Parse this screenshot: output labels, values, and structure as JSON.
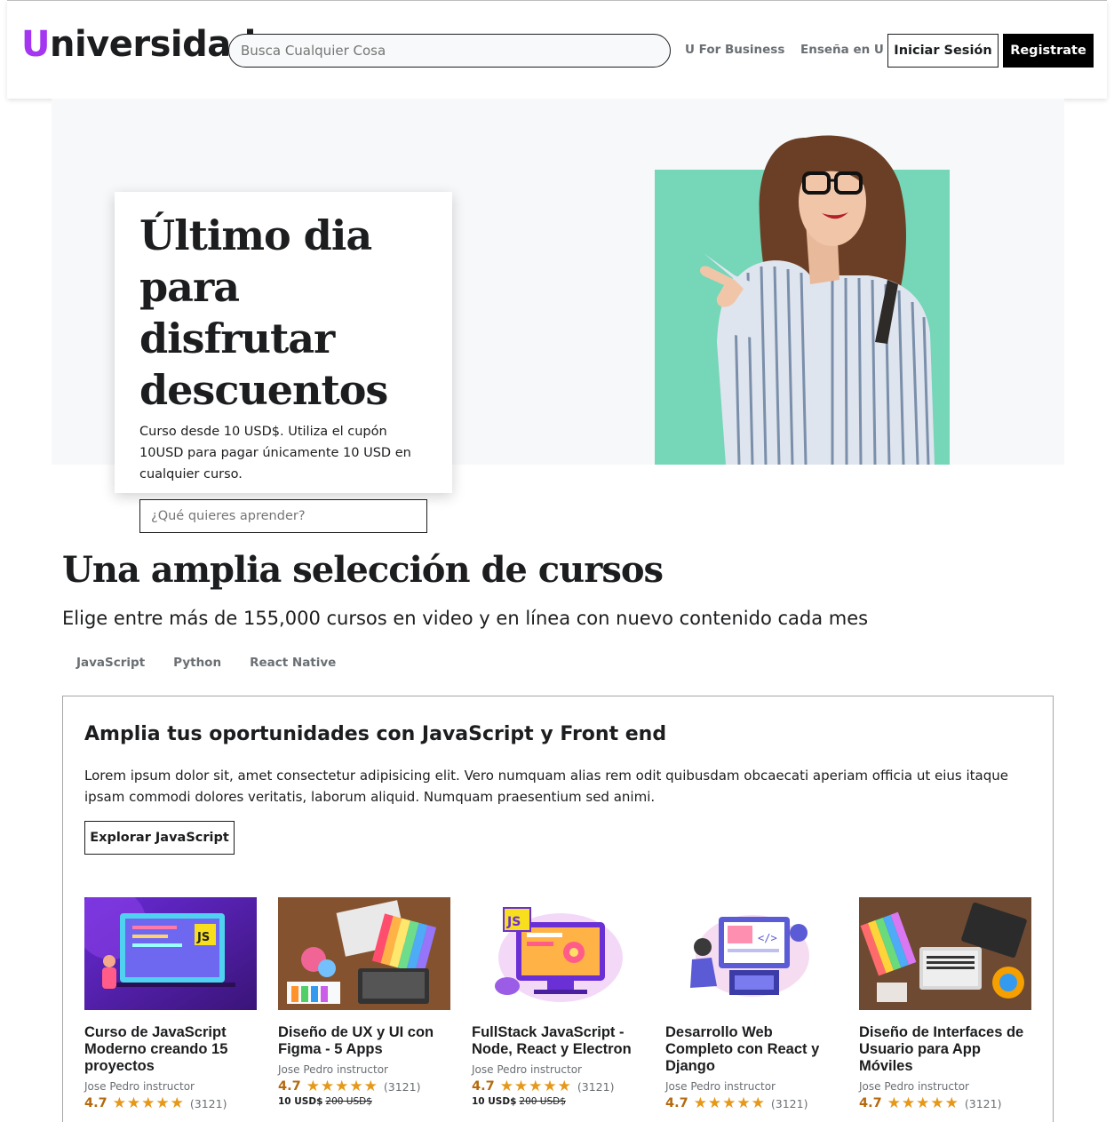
{
  "header": {
    "logo_initial": "U",
    "logo_rest": "niversidad",
    "search_placeholder": "Busca Cualquier Cosa",
    "link_business": "U For Business",
    "link_teach": "Enseña en U",
    "login_label": "Iniciar Sesión",
    "register_label": "Registrate"
  },
  "hero": {
    "title": "Último dia para disfrutar descuentos",
    "text": "Curso desde 10 USD$. Utiliza el cupón 10USD para pagar únicamente 10 USD en cualquier curso.",
    "input_placeholder": "¿Qué quieres aprender?"
  },
  "section": {
    "title": "Una amplia selección de cursos",
    "subtitle": "Elige entre más de 155,000 cursos en video y en línea con nuevo contenido cada mes",
    "tabs": [
      "JavaScript",
      "Python",
      "React Native"
    ]
  },
  "box": {
    "title": "Amplia tus oportunidades con JavaScript y Front end",
    "text": "Lorem ipsum dolor sit, amet consectetur adipisicing elit. Vero numquam alias rem odit quibusdam obcaecati aperiam officia ut eius itaque ipsam commodi dolores veritatis, laborum aliquid. Numquam praesentium sed animi.",
    "button_label": "Explorar JavaScript"
  },
  "courses": [
    {
      "title": "Curso de JavaScript Moderno creando 15 proyectos",
      "instructor": "Jose Pedro instructor",
      "rating": "4.7",
      "stars": "★★★★★",
      "count": "(3121)",
      "price": "",
      "old_price": ""
    },
    {
      "title": "Diseño de UX y UI con Figma - 5 Apps",
      "instructor": "Jose Pedro instructor",
      "rating": "4.7",
      "stars": "★★★★★",
      "count": "(3121)",
      "price": "10 USD$",
      "old_price": "200 USD$"
    },
    {
      "title": "FullStack JavaScript - Node, React y Electron",
      "instructor": "Jose Pedro instructor",
      "rating": "4.7",
      "stars": "★★★★★",
      "count": "(3121)",
      "price": "10 USD$",
      "old_price": "200 USD$"
    },
    {
      "title": "Desarrollo Web Completo con React y Django",
      "instructor": "Jose Pedro instructor",
      "rating": "4.7",
      "stars": "★★★★★",
      "count": "(3121)",
      "price": "",
      "old_price": ""
    },
    {
      "title": "Diseño de Interfaces de Usuario para App Móviles",
      "instructor": "Jose Pedro instructor",
      "rating": "4.7",
      "stars": "★★★★★",
      "count": "(3121)",
      "price": "",
      "old_price": ""
    }
  ],
  "colors": {
    "brand_purple": "#a435f0",
    "hero_teal": "#75d6b8",
    "star_orange": "#e59819",
    "rating_text": "#b4690e"
  }
}
